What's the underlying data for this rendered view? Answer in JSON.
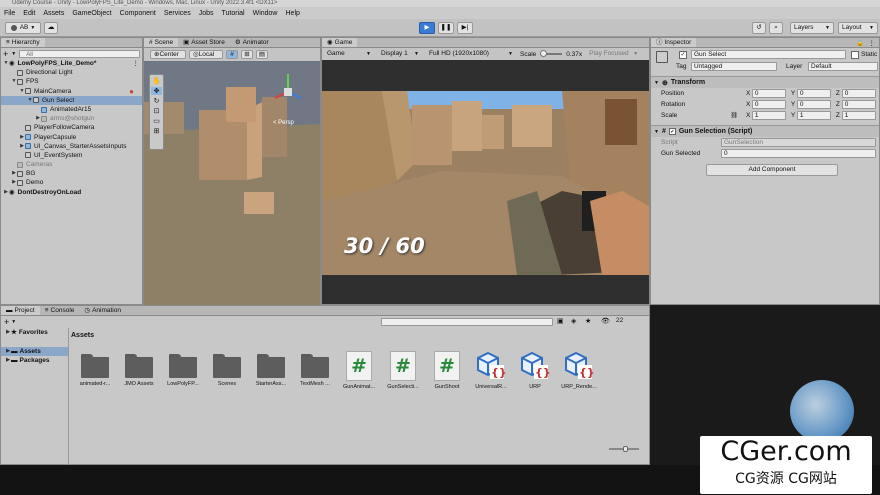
{
  "window": {
    "title": "Udemy Course - Unity - LowPolyFPS_Lite_Demo - Windows, Mac, Linux - Unity 2022.3.4f1 <DX11>"
  },
  "menu": [
    "File",
    "Edit",
    "Assets",
    "GameObject",
    "Component",
    "Services",
    "Jobs",
    "Tutorial",
    "Window",
    "Help"
  ],
  "toolbar": {
    "account": "AB",
    "layers": "Layers",
    "layout": "Layout"
  },
  "hierarchy": {
    "tab": "Hierarchy",
    "search_placeholder": "All",
    "items": [
      {
        "label": "LowPolyFPS_Lite_Demo*",
        "depth": 0,
        "icon": "scene"
      },
      {
        "label": "Directional Light",
        "depth": 1,
        "icon": "cube"
      },
      {
        "label": "FPS",
        "depth": 1,
        "icon": "cube"
      },
      {
        "label": "MainCamera",
        "depth": 2,
        "icon": "cube"
      },
      {
        "label": "Gun Select",
        "depth": 3,
        "icon": "cube"
      },
      {
        "label": "AnimatedAr15",
        "depth": 4,
        "icon": "prefab"
      },
      {
        "label": "arms@shotgun",
        "depth": 4,
        "icon": "prefab-grey"
      },
      {
        "label": "PlayerFollowCamera",
        "depth": 2,
        "icon": "cube"
      },
      {
        "label": "PlayerCapsule",
        "depth": 2,
        "icon": "prefab"
      },
      {
        "label": "UI_Canvas_StarterAssetsInputs",
        "depth": 2,
        "icon": "prefab"
      },
      {
        "label": "UI_EventSystem",
        "depth": 2,
        "icon": "cube"
      },
      {
        "label": "Cameras",
        "depth": 1,
        "icon": "cube-grey"
      },
      {
        "label": "BG",
        "depth": 1,
        "icon": "cube"
      },
      {
        "label": "Demo",
        "depth": 1,
        "icon": "cube"
      },
      {
        "label": "DontDestroyOnLoad",
        "depth": 0,
        "icon": "scene"
      }
    ]
  },
  "scene_tabs": [
    "Scene",
    "Asset Store",
    "Animator"
  ],
  "scene": {
    "pivot": "Center",
    "space": "Local",
    "persp": "< Persp"
  },
  "game": {
    "tab": "Game",
    "mode": "Game",
    "display": "Display 1",
    "resolution": "Full HD (1920x1080)",
    "scale_label": "Scale",
    "scale_value": "0.37x",
    "play_focused": "Play Focused",
    "ammo": "30 / 60"
  },
  "inspector": {
    "tab": "Inspector",
    "object_name": "Gun Select",
    "static_label": "Static",
    "tag_label": "Tag",
    "tag_value": "Untagged",
    "layer_label": "Layer",
    "layer_value": "Default",
    "transform": {
      "title": "Transform",
      "rows": [
        {
          "label": "Position",
          "x": "0",
          "y": "0",
          "z": "0"
        },
        {
          "label": "Rotation",
          "x": "0",
          "y": "0",
          "z": "0"
        },
        {
          "label": "Scale",
          "x": "1",
          "y": "1",
          "z": "1"
        }
      ]
    },
    "script_component": {
      "title": "Gun Selection (Script)",
      "script_label": "Script",
      "script_value": "GunSelection",
      "field_label": "Gun Selected",
      "field_value": "0"
    },
    "add_component": "Add Component"
  },
  "project": {
    "tabs": [
      "Project",
      "Console",
      "Animation"
    ],
    "favorites": "Favorites",
    "assets_root": "Assets",
    "packages": "Packages",
    "breadcrumb": "Assets",
    "hidden_count": "22",
    "assets": [
      {
        "name": "animated-r...",
        "type": "folder"
      },
      {
        "name": "JMO Assets",
        "type": "folder"
      },
      {
        "name": "LowPolyFP...",
        "type": "folder"
      },
      {
        "name": "Scenes",
        "type": "folder"
      },
      {
        "name": "StarterAss...",
        "type": "folder"
      },
      {
        "name": "TextMesh ...",
        "type": "folder"
      },
      {
        "name": "GunAnimat...",
        "type": "script"
      },
      {
        "name": "GunSelecti...",
        "type": "script"
      },
      {
        "name": "GunShoot",
        "type": "script"
      },
      {
        "name": "UniversalR...",
        "type": "package"
      },
      {
        "name": "URP",
        "type": "package"
      },
      {
        "name": "URP_Rende...",
        "type": "package"
      }
    ]
  },
  "watermark": {
    "main": "CGer.com",
    "sub": "CG资源 CG网站"
  },
  "colors": {
    "accent": "#3a7bd5",
    "selection": "#8aa7c9",
    "panel": "#c8c8c8"
  }
}
